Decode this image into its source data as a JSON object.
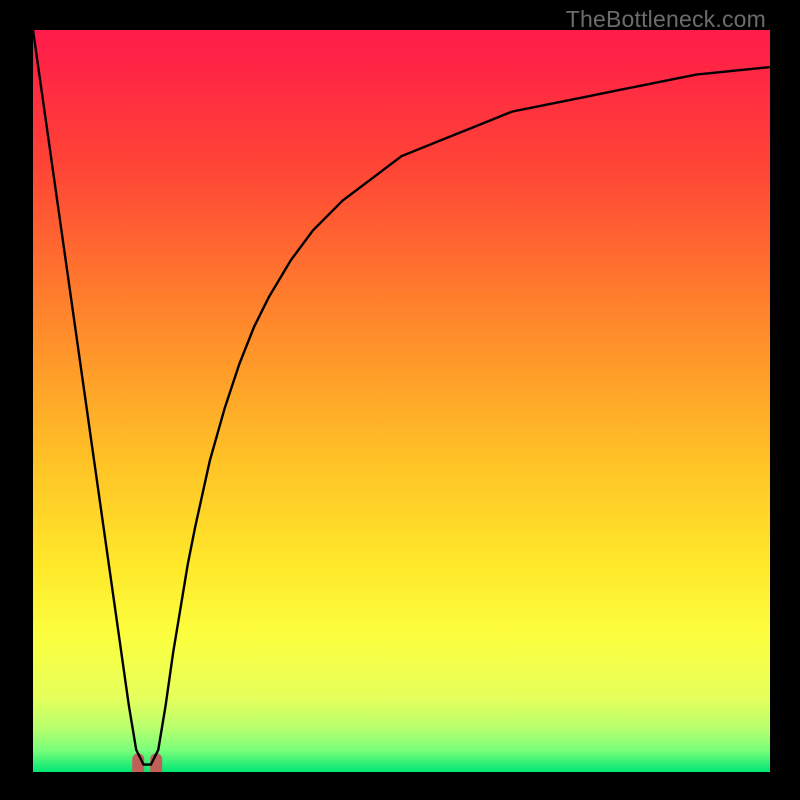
{
  "watermark": "TheBottleneck.com",
  "colors": {
    "frame": "#000000",
    "gradient_stops": [
      {
        "offset": 0.0,
        "color": "#ff1b4a"
      },
      {
        "offset": 0.18,
        "color": "#ff4336"
      },
      {
        "offset": 0.4,
        "color": "#ff8a2b"
      },
      {
        "offset": 0.58,
        "color": "#ffc226"
      },
      {
        "offset": 0.72,
        "color": "#ffe82a"
      },
      {
        "offset": 0.82,
        "color": "#fbff3f"
      },
      {
        "offset": 0.9,
        "color": "#e6ff5c"
      },
      {
        "offset": 0.94,
        "color": "#b8ff6d"
      },
      {
        "offset": 0.97,
        "color": "#7cff7a"
      },
      {
        "offset": 1.0,
        "color": "#00e675"
      }
    ],
    "valley_marker": "#c06058",
    "curve_stroke": "#000000"
  },
  "chart_data": {
    "type": "line",
    "title": "",
    "xlabel": "",
    "ylabel": "",
    "xlim": [
      0,
      100
    ],
    "ylim": [
      0,
      100
    ],
    "x": [
      0,
      1,
      2,
      3,
      4,
      5,
      6,
      7,
      8,
      9,
      10,
      11,
      12,
      13,
      14,
      15,
      16,
      17,
      18,
      19,
      20,
      21,
      22,
      24,
      26,
      28,
      30,
      32,
      35,
      38,
      42,
      46,
      50,
      55,
      60,
      65,
      70,
      75,
      80,
      85,
      90,
      95,
      100
    ],
    "values": [
      100,
      93,
      86,
      79,
      72,
      65,
      58,
      51,
      44,
      37,
      30,
      23,
      16,
      9,
      3,
      1,
      1,
      3,
      9,
      16,
      22,
      28,
      33,
      42,
      49,
      55,
      60,
      64,
      69,
      73,
      77,
      80,
      83,
      85,
      87,
      89,
      90,
      91,
      92,
      93,
      94,
      94.5,
      95
    ],
    "valley_x": 15.5,
    "valley_y": 0.5,
    "annotations": [],
    "legend": []
  }
}
